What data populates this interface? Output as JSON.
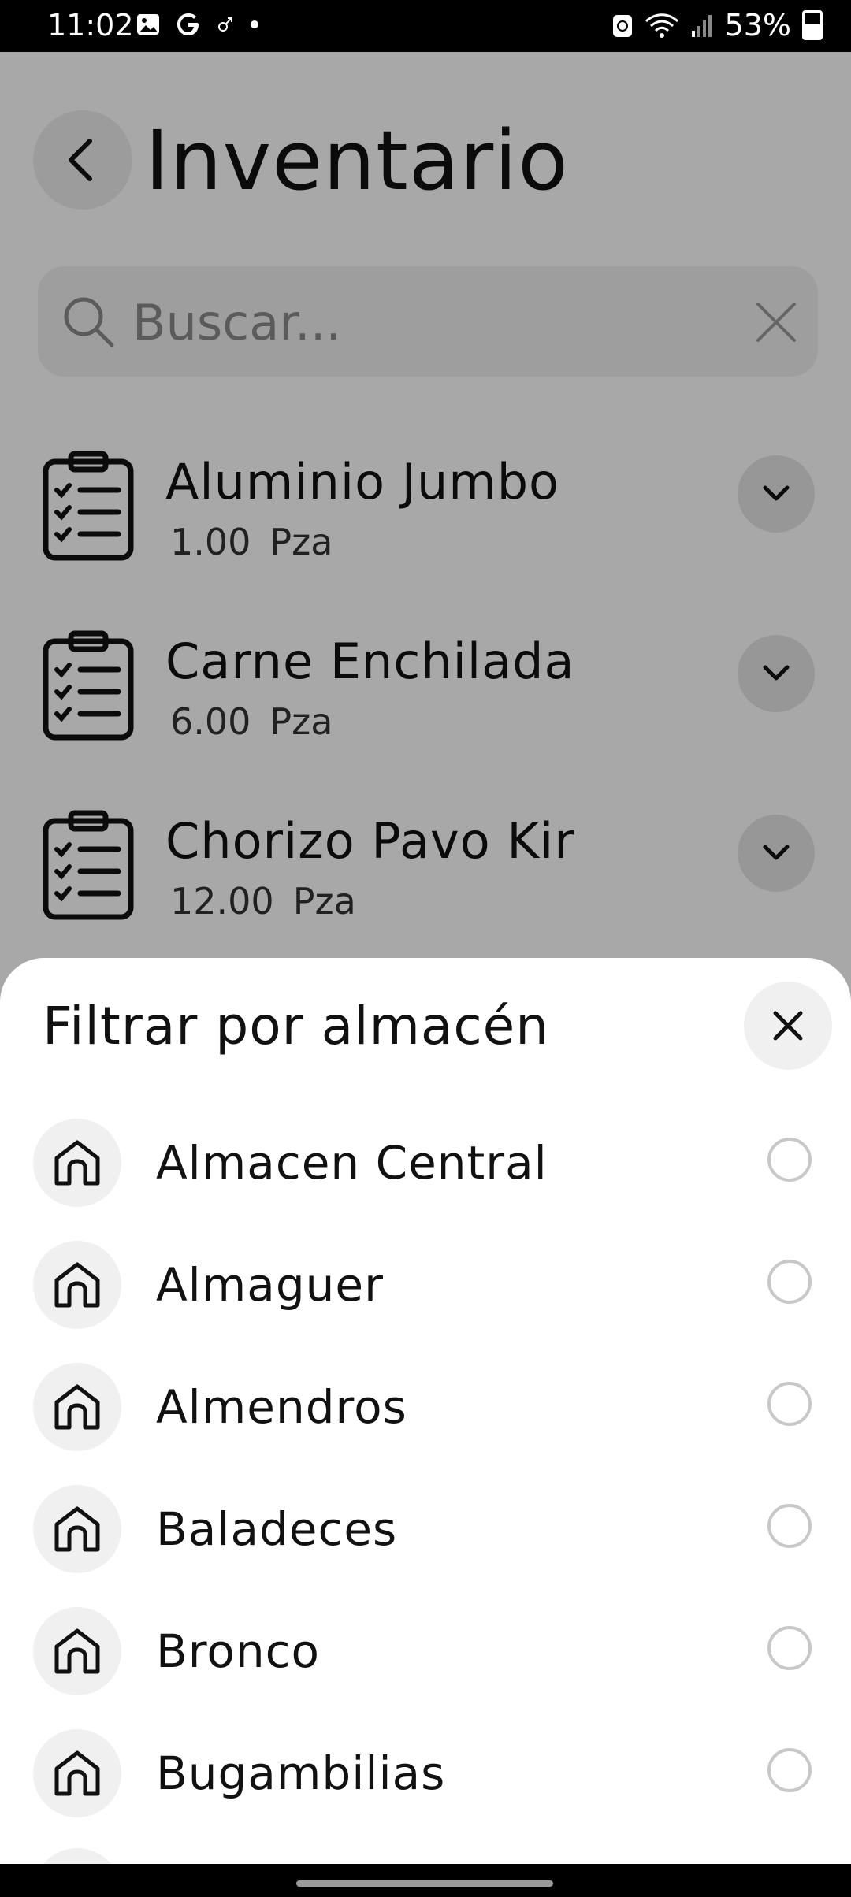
{
  "status_bar": {
    "time": "11:02",
    "left_icons": [
      "image-icon",
      "google-icon",
      "mars-icon",
      "dot-icon"
    ],
    "right_icons": [
      "sync-icon",
      "wifi-icon",
      "signal-icon",
      "battery-icon"
    ],
    "battery": "53%"
  },
  "header": {
    "title": "Inventario",
    "back_icon": "chevron-left-icon"
  },
  "search": {
    "placeholder": "Buscar...",
    "value": ""
  },
  "inventory": {
    "items": [
      {
        "name": "Aluminio Jumbo",
        "qty": "1.00",
        "unit": "Pza"
      },
      {
        "name": "Carne Enchilada",
        "qty": "6.00",
        "unit": "Pza"
      },
      {
        "name": "Chorizo Pavo Kir",
        "qty": "12.00",
        "unit": "Pza"
      }
    ]
  },
  "filter_sheet": {
    "title": "Filtrar por almacén",
    "options": [
      {
        "label": "Almacen Central",
        "selected": false
      },
      {
        "label": "Almaguer",
        "selected": false
      },
      {
        "label": "Almendros",
        "selected": false
      },
      {
        "label": "Baladeces",
        "selected": false
      },
      {
        "label": "Bronco",
        "selected": false
      },
      {
        "label": "Bugambilias",
        "selected": false
      }
    ]
  },
  "colors": {
    "scrim": "#000000",
    "surface": "#ffffff",
    "icon_bg": "#f0f0f0",
    "text": "#111111"
  }
}
